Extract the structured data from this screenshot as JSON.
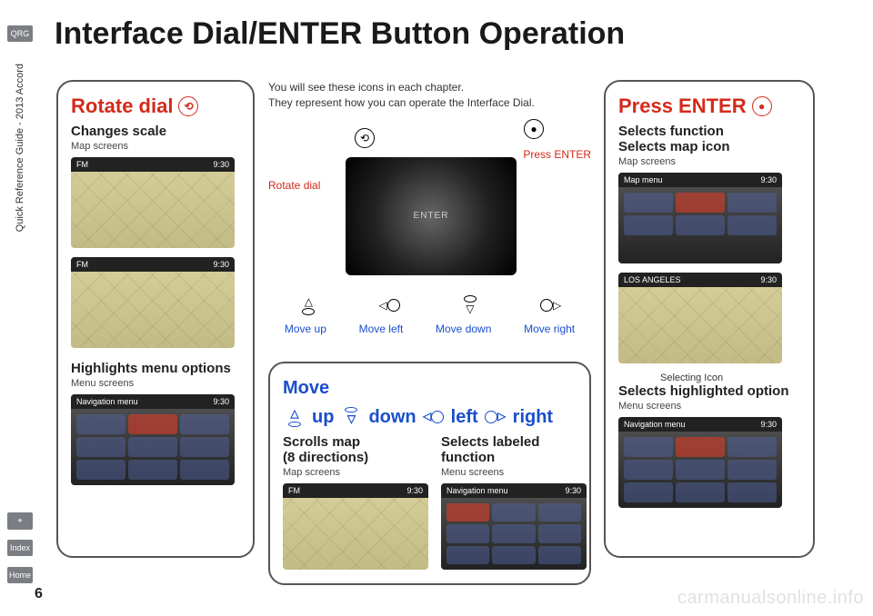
{
  "page": {
    "title": "Interface Dial/ENTER Button Operation",
    "number": "6",
    "side_guide": "Quick Reference Guide - 2013 Accord",
    "watermark": "carmanualsonline.info"
  },
  "tabs": {
    "qrg": "QRG",
    "nav": "⌖",
    "index": "Index",
    "home": "Home"
  },
  "desc": {
    "line1": "You will see these icons in each chapter.",
    "line2": "They represent how you can operate the Interface Dial."
  },
  "dial_labels": {
    "rotate": "Rotate dial",
    "press": "Press ENTER",
    "up": "Move up",
    "down": "Move down",
    "left": "Move left",
    "right": "Move right",
    "enter_word": "ENTER"
  },
  "rotate_panel": {
    "title": "Rotate dial",
    "sub1": "Changes scale",
    "cap1": "Map screens",
    "sub2": "Highlights menu options",
    "cap2": "Menu screens"
  },
  "move_panel": {
    "title": "Move",
    "up": "up",
    "down": "down",
    "left": "left",
    "right": "right",
    "col1_sub": "Scrolls map",
    "col1_sub2": "(8 directions)",
    "col1_cap": "Map screens",
    "col2_sub": "Selects labeled",
    "col2_sub2": "function",
    "col2_cap": "Menu screens"
  },
  "enter_panel": {
    "title": "Press ENTER",
    "sub1": "Selects function",
    "sub1b": "Selects map icon",
    "cap1": "Map screens",
    "pointer": "Selecting Icon",
    "sub2": "Selects highlighted option",
    "cap2": "Menu screens"
  },
  "screens": {
    "fm": "FM",
    "time": "9:30",
    "navmenu": "Navigation menu",
    "mapmenu": "Map menu",
    "la": "LOS ANGELES"
  }
}
